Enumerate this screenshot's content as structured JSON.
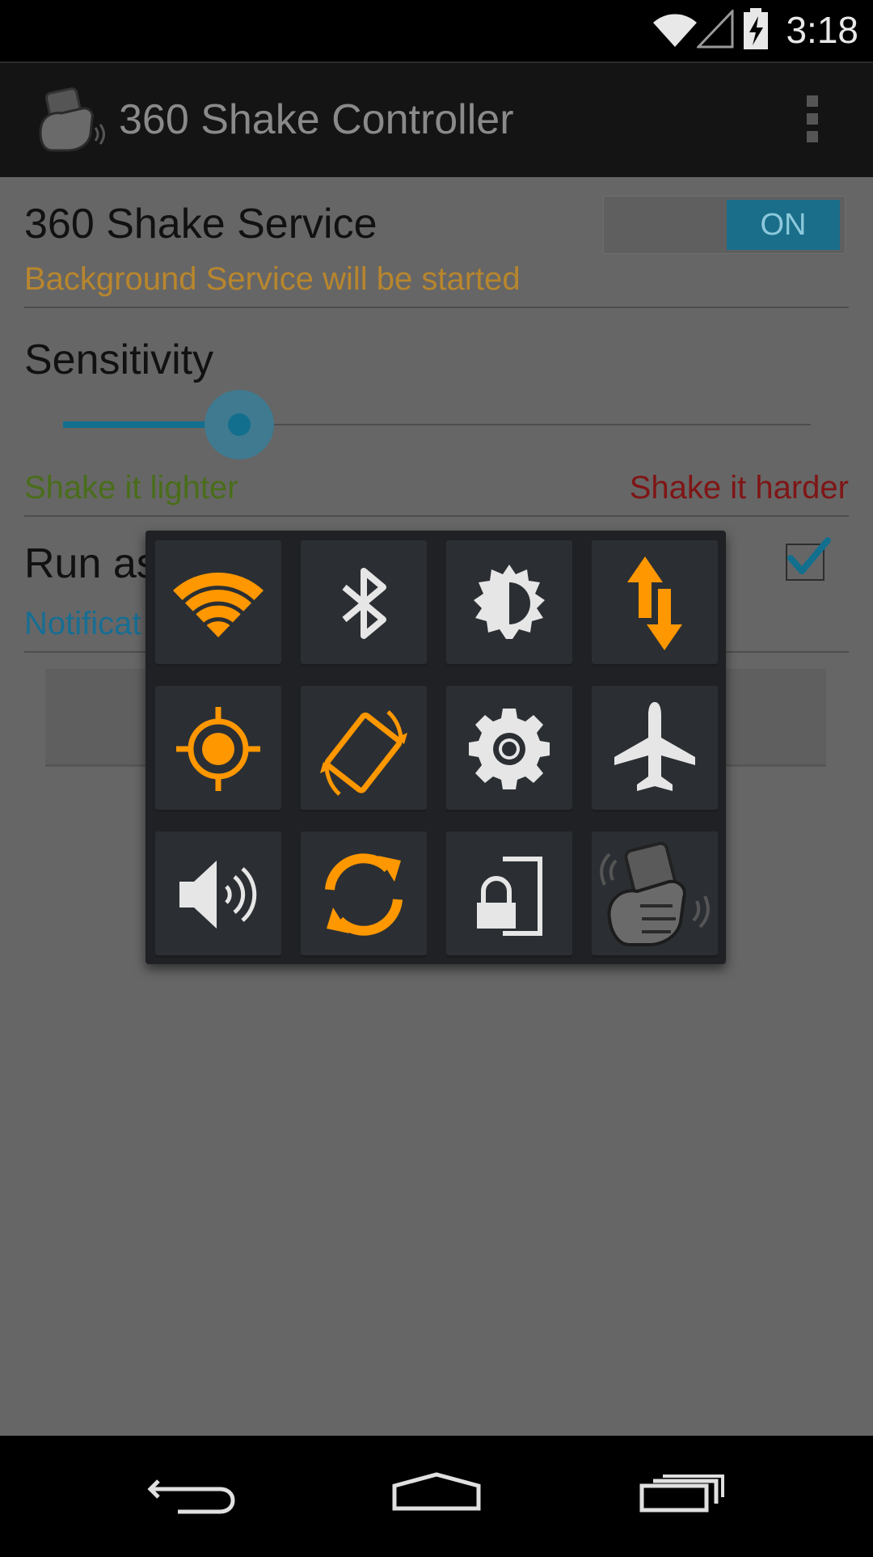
{
  "status_bar": {
    "time": "3:18"
  },
  "app_bar": {
    "title": "360 Shake Controller"
  },
  "settings": {
    "service": {
      "title": "360 Shake Service",
      "subtitle": "Background Service will be started",
      "toggle_label": "ON"
    },
    "sensitivity": {
      "title": "Sensitivity",
      "left_label": "Shake it lighter",
      "right_label": "Shake it harder",
      "level_fraction": 0.25
    },
    "run_as": {
      "title": "Run as",
      "subtitle": "Notificat",
      "checked": true
    }
  },
  "colors": {
    "service_subtitle": "#b8862d",
    "lighter": "#4a6d1a",
    "harder": "#7f1515",
    "accent": "#136f8e",
    "notification": "#176e93",
    "orange": "#ff9700",
    "icon_light": "#e6e6e6"
  },
  "quick_toggles": [
    {
      "icon": "wifi-icon",
      "active": true
    },
    {
      "icon": "bluetooth-icon",
      "active": false
    },
    {
      "icon": "brightness-icon",
      "active": false
    },
    {
      "icon": "mobile-data-icon",
      "active": true
    },
    {
      "icon": "location-icon",
      "active": true
    },
    {
      "icon": "auto-rotate-icon",
      "active": true
    },
    {
      "icon": "settings-icon",
      "active": false
    },
    {
      "icon": "airplane-icon",
      "active": false
    },
    {
      "icon": "volume-icon",
      "active": false
    },
    {
      "icon": "sync-icon",
      "active": true
    },
    {
      "icon": "screen-lock-icon",
      "active": false
    },
    {
      "icon": "shake-app-icon",
      "active": false
    }
  ],
  "nav_bar": {
    "buttons": [
      "back-icon",
      "home-icon",
      "recents-icon"
    ]
  }
}
